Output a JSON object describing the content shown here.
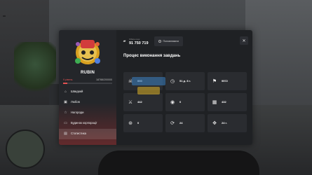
{
  "hud": {
    "top_left": "",
    "top_right": "",
    "bottom_right": ""
  },
  "profile": {
    "name": "RUBIN",
    "level_label": "9 рівень",
    "xp_text": "18788/200000",
    "xp_fraction": 0.09
  },
  "menu": [
    {
      "icon": "home-icon",
      "title": "Швидкий",
      "sub": "",
      "active": false
    },
    {
      "icon": "bag-icon",
      "title": "Любов",
      "sub": "",
      "active": false
    },
    {
      "icon": "star-icon",
      "title": "Нагороди",
      "sub": "",
      "active": false
    },
    {
      "icon": "card-icon",
      "title": "Будинок корпорації",
      "sub": "",
      "active": false
    },
    {
      "icon": "chart-icon",
      "title": "Статистика",
      "sub": "",
      "active": true
    }
  ],
  "topbar": {
    "money_label": "Обмін очок",
    "money_value": "91 750 719",
    "donate_label": "Поповнювати",
    "close_glyph": "✕"
  },
  "content": {
    "title": "Процес виконання завдань",
    "subtitle": ""
  },
  "stats": [
    {
      "icon": "skull-icon",
      "value": "000",
      "label": ""
    },
    {
      "icon": "clock-icon",
      "value": "51 д. 8 г.",
      "label": ""
    },
    {
      "icon": "flag-icon",
      "value": "9572",
      "label": ""
    },
    {
      "icon": "knife-icon",
      "value": "442",
      "label": ""
    },
    {
      "icon": "coin-icon",
      "value": "0",
      "label": ""
    },
    {
      "icon": "briefcase-icon",
      "value": "432",
      "label": ""
    },
    {
      "icon": "steering-icon",
      "value": "0",
      "label": ""
    },
    {
      "icon": "timer-icon",
      "value": "24",
      "label": ""
    },
    {
      "icon": "move-icon",
      "value": "24 г.",
      "label": ""
    }
  ],
  "colors": {
    "accent": "#e35252",
    "panel": "#1f2124",
    "sidebar": "#24262a",
    "card": "#2a2c30"
  }
}
